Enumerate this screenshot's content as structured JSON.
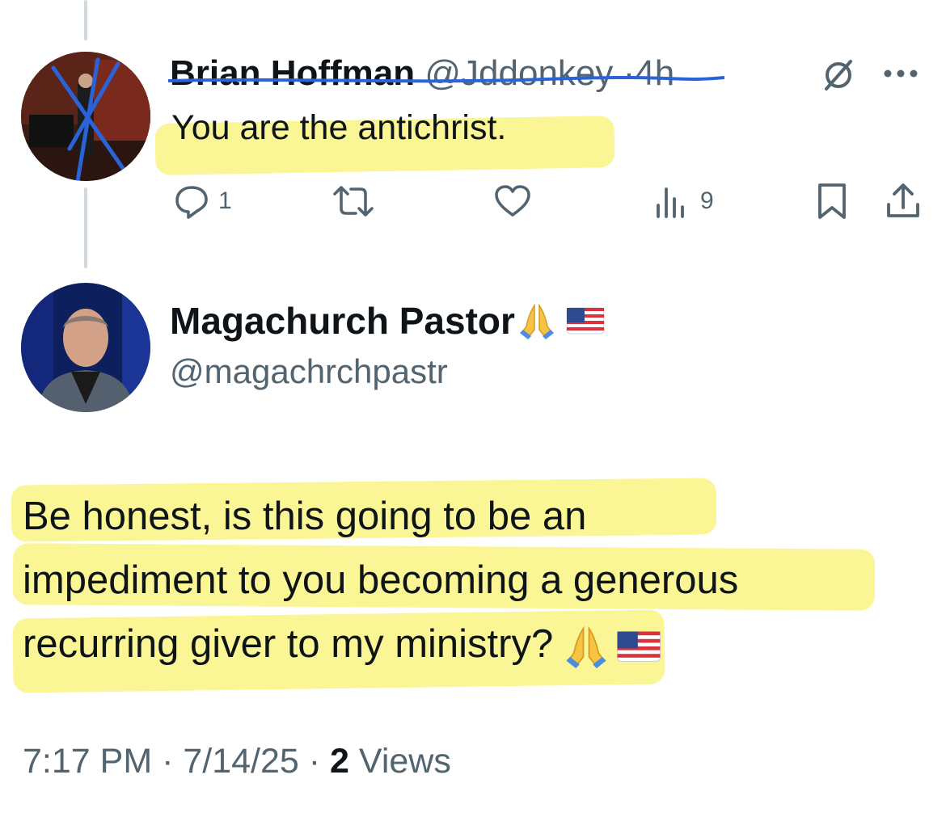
{
  "reply": {
    "display_name": "Brian Hoffman",
    "handle": "@Jddonkey",
    "separator": "·",
    "time": "4h",
    "text": "You are the antichrist.",
    "actions": {
      "reply_count": "1",
      "retweet_count": "",
      "like_count": "",
      "views_count": "9"
    }
  },
  "main_tweet": {
    "display_name": "Magachurch Pastor",
    "name_emojis": [
      "folded-hands",
      "us-flag"
    ],
    "handle": "@magachrchpastr",
    "body_lines": [
      "Be honest, is this going to be an",
      "impediment to you becoming a generous",
      "recurring giver to my ministry?"
    ],
    "body_emojis": [
      "folded-hands",
      "us-flag"
    ],
    "time": "7:17 PM",
    "date": "7/14/25",
    "sep1": " · ",
    "sep2": " · ",
    "views_count": "2",
    "views_label": " Views"
  },
  "colors": {
    "text": "#0f1419",
    "muted": "#536471",
    "highlight": "#fbf58a",
    "scribble": "#2a63d8",
    "thread_line": "#cfd9de"
  },
  "icons": [
    "reply-icon",
    "retweet-icon",
    "like-icon",
    "views-icon",
    "bookmark-icon",
    "share-icon",
    "grok-icon",
    "more-icon"
  ]
}
